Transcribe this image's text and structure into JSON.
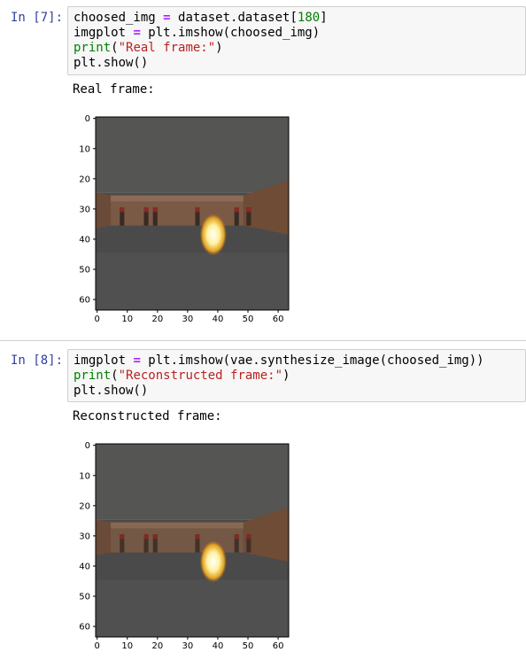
{
  "cells": [
    {
      "prompt": "In [7]:",
      "code": [
        [
          {
            "t": "choosed_img "
          },
          {
            "t": "=",
            "c": "op"
          },
          {
            "t": " dataset.dataset["
          },
          {
            "t": "180",
            "c": "num"
          },
          {
            "t": "]"
          }
        ],
        [
          {
            "t": "imgplot "
          },
          {
            "t": "=",
            "c": "op"
          },
          {
            "t": " plt.imshow(choosed_img)"
          }
        ],
        [
          {
            "t": "print",
            "c": "kw"
          },
          {
            "t": "("
          },
          {
            "t": "\"Real frame:\"",
            "c": "str"
          },
          {
            "t": ")"
          }
        ],
        [
          {
            "t": "plt.show()"
          }
        ]
      ],
      "output_text": "Real frame:",
      "image_kind": "real"
    },
    {
      "prompt": "In [8]:",
      "code": [
        [
          {
            "t": "imgplot "
          },
          {
            "t": "=",
            "c": "op"
          },
          {
            "t": " plt.imshow(vae.synthesize_image(choosed_img))"
          }
        ],
        [
          {
            "t": "print",
            "c": "kw"
          },
          {
            "t": "("
          },
          {
            "t": "\"Reconstructed frame:\"",
            "c": "str"
          },
          {
            "t": ")"
          }
        ],
        [
          {
            "t": "plt.show()"
          }
        ]
      ],
      "output_text": "Reconstructed frame:",
      "image_kind": "reconstructed"
    }
  ],
  "axes": {
    "y_ticks": [
      0,
      10,
      20,
      30,
      40,
      50,
      60
    ],
    "x_ticks": [
      0,
      10,
      20,
      30,
      40,
      50,
      60
    ],
    "xlim": [
      0,
      64
    ],
    "ylim": [
      0,
      64
    ]
  },
  "colors": {
    "prompt": "#303f9f",
    "cell_bg": "#f7f7f7",
    "floor": "#4a4a4a",
    "wall": "#7a5a45",
    "fireball": "#fff2a0"
  }
}
